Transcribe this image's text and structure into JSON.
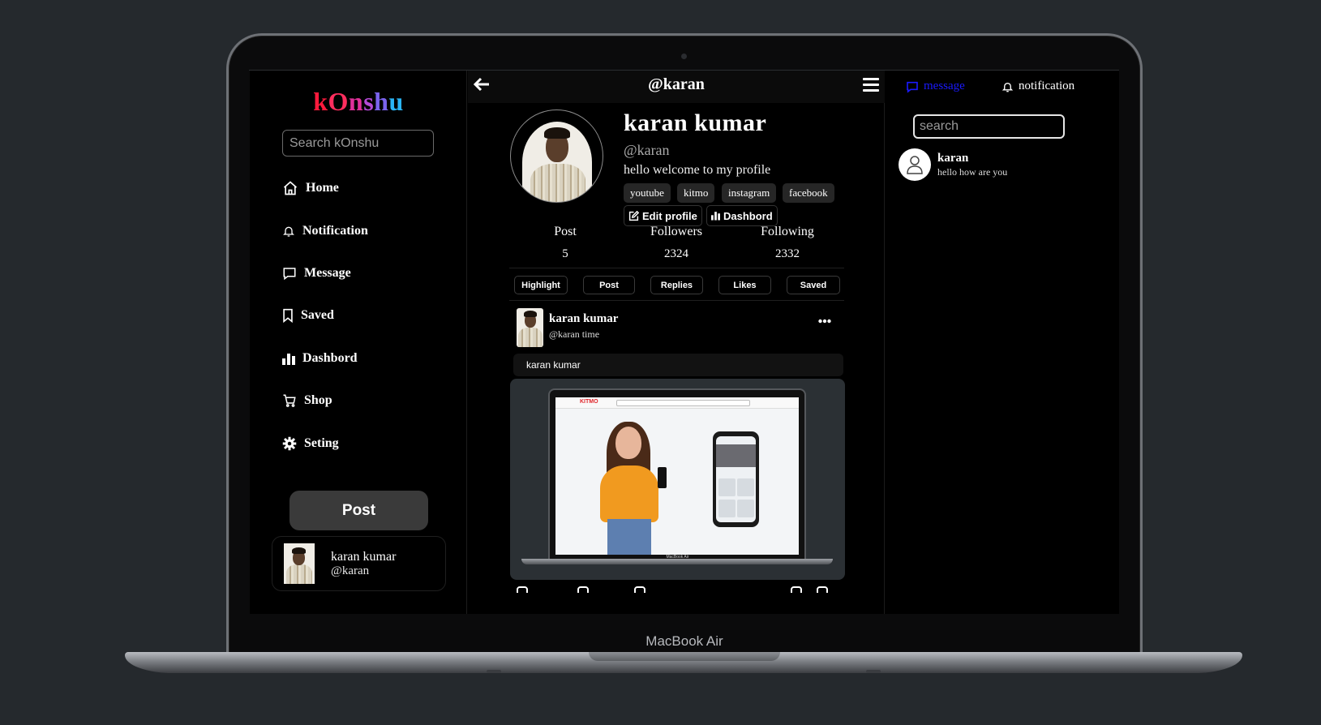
{
  "device": {
    "label": "MacBook Air"
  },
  "sidebar": {
    "logo": [
      "k",
      "O",
      "n",
      "s",
      "h",
      "u"
    ],
    "search_placeholder": "Search kOnshu",
    "nav": [
      {
        "label": "Home",
        "icon": "home-icon"
      },
      {
        "label": "Notification",
        "icon": "bell-icon"
      },
      {
        "label": "Message",
        "icon": "message-icon"
      },
      {
        "label": "Saved",
        "icon": "bookmark-icon"
      },
      {
        "label": "Dashbord",
        "icon": "bar-chart-icon"
      },
      {
        "label": "Shop",
        "icon": "cart-icon"
      },
      {
        "label": "Seting",
        "icon": "gear-icon"
      }
    ],
    "post_button": "Post",
    "account": {
      "name": "karan kumar",
      "handle": "@karan"
    }
  },
  "header": {
    "title": "@karan"
  },
  "profile": {
    "name": "karan kumar",
    "handle": "@karan",
    "bio": "hello welcome to my profile",
    "links": [
      "youtube",
      "kitmo",
      "instagram",
      "facebook"
    ],
    "edit_button": "Edit profile",
    "dashboard_button": "Dashbord",
    "stats": [
      {
        "label": "Post",
        "value": "5"
      },
      {
        "label": "Followers",
        "value": "2324"
      },
      {
        "label": "Following",
        "value": "2332"
      }
    ],
    "tabs": [
      "Highlight",
      "Post",
      "Replies",
      "Likes",
      "Saved"
    ]
  },
  "post": {
    "author": "karan kumar",
    "meta": "@karan time",
    "text": "karan kumar",
    "media": {
      "site_logo": "KITMO",
      "laptop_label": "MacBook Air"
    }
  },
  "right_panel": {
    "tabs": [
      {
        "label": "message",
        "active": true
      },
      {
        "label": "notification",
        "active": false
      }
    ],
    "search_placeholder": "search",
    "chats": [
      {
        "name": "karan",
        "message": "hello how are you"
      }
    ]
  },
  "colors": {
    "background": "#25292d",
    "screen": "#000000",
    "active_tab": "#1a1aff",
    "logo_gradient": [
      "#ff1a3c",
      "#e0309a",
      "#7b63ee",
      "#2ab4f5"
    ]
  }
}
